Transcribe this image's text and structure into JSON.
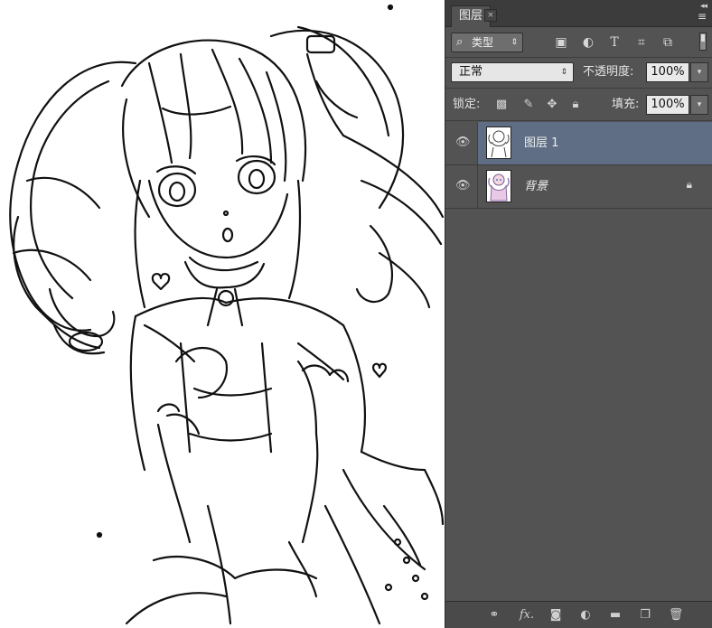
{
  "panel": {
    "tab_label": "图层",
    "tab_close": "×",
    "collapse_glyph": "◂◂",
    "menu_glyph": "≡",
    "filter": {
      "value": "类型",
      "arrow": "⇕"
    },
    "filter_icons": [
      "image-filter-icon",
      "adjustment-filter-icon",
      "type-filter-icon",
      "shape-filter-icon",
      "smart-object-filter-icon"
    ],
    "blend_mode": "正常",
    "opacity_label": "不透明度:",
    "opacity_value": "100%",
    "lock_label": "锁定:",
    "fill_label": "填充:",
    "fill_value": "100%",
    "arrow_down": "▾"
  },
  "layers": [
    {
      "name": "图层 1",
      "selected": true,
      "visible": true,
      "locked": false
    },
    {
      "name": "背景",
      "selected": false,
      "visible": true,
      "locked": true
    }
  ],
  "bottom_icons": [
    "link-layers-icon",
    "fx-icon",
    "layer-mask-icon",
    "adjustment-layer-icon",
    "group-folder-icon",
    "new-layer-icon",
    "trash-icon"
  ],
  "colors": {
    "panel_bg": "#535353",
    "selected_row": "#5f6e85",
    "canvas_bg": "#ffffff"
  }
}
